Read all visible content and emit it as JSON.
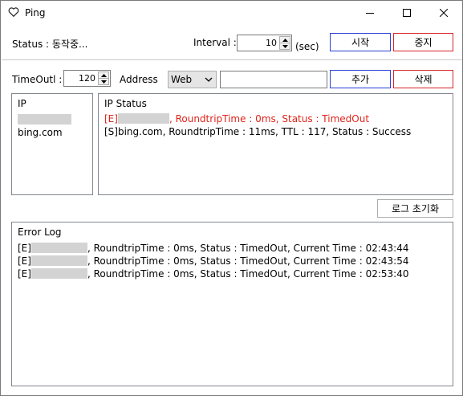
{
  "window": {
    "title": "Ping"
  },
  "controls": {
    "status_text": "Status : 동작중...",
    "interval_label": "Interval :",
    "interval_value": "10",
    "interval_unit": "(sec)",
    "start_label": "시작",
    "stop_label": "중지",
    "timeout_label": "TimeOutl :",
    "timeout_value": "120",
    "address_label": "Address",
    "address_type": "Web",
    "address_value": "",
    "add_label": "추가",
    "delete_label": "삭제",
    "clear_log_label": "로그 초기화"
  },
  "ip_list": {
    "header": "IP",
    "items": [
      "",
      "bing.com"
    ]
  },
  "ip_status": {
    "header": "IP Status",
    "lines": [
      {
        "prefix": "[E]",
        "host": "",
        "text": ", RoundtripTime : 0ms, Status : TimedOut"
      },
      {
        "prefix": "[S]",
        "host": "bing.com",
        "text": ", RoundtripTime : 11ms, TTL : 117, Status : Success"
      }
    ]
  },
  "error_log": {
    "header": "Error Log",
    "lines": [
      {
        "prefix": "[E]",
        "host": "",
        "text": ", RoundtripTime : 0ms, Status : TimedOut, Current Time : 02:43:44"
      },
      {
        "prefix": "[E]",
        "host": "",
        "text": ", RoundtripTime : 0ms, Status : TimedOut, Current Time : 02:43:54"
      },
      {
        "prefix": "[E]",
        "host": "",
        "text": ", RoundtripTime : 0ms, Status : TimedOut, Current Time : 02:53:40"
      }
    ]
  },
  "colors": {
    "error": "#e0251b",
    "start_border": "#2b3fd6",
    "stop_border": "#d9262c"
  },
  "icons": [
    "heart-icon",
    "minimize-icon",
    "maximize-icon",
    "close-icon",
    "spin-up-icon",
    "spin-down-icon",
    "chevron-down-icon"
  ]
}
